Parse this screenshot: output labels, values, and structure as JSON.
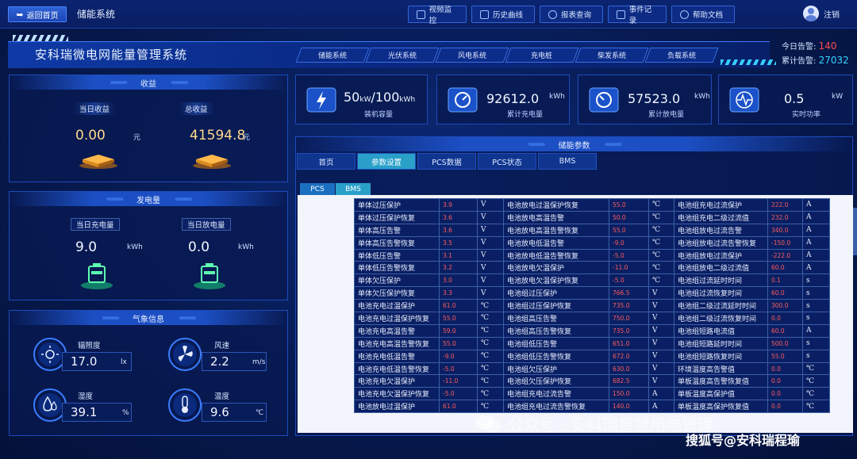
{
  "topbar": {
    "back_label": "返回首页",
    "system_name": "储能系统",
    "nav": [
      "视频监控",
      "历史曲线",
      "报表查询",
      "事件记录",
      "帮助文档"
    ],
    "user_label": "注销"
  },
  "header": {
    "title": "安科瑞微电网能量管理系统",
    "subnav": [
      "储能系统",
      "光伏系统",
      "风电系统",
      "充电桩",
      "柴发系统",
      "负载系统"
    ],
    "alarm_today_label": "今日告警:",
    "alarm_today_value": "140",
    "alarm_total_label": "累计告警:",
    "alarm_total_value": "27032"
  },
  "income": {
    "title": "收益",
    "today_label": "当日收益",
    "today_value": "0.00",
    "today_unit": "元",
    "total_label": "总收益",
    "total_value": "41594.8",
    "total_unit": "元"
  },
  "generation": {
    "title": "发电量",
    "charge_label": "当日充电量",
    "charge_value": "9.0",
    "charge_unit": "kWh",
    "discharge_label": "当日放电量",
    "discharge_value": "0.0",
    "discharge_unit": "kWh"
  },
  "weather": {
    "title": "气象信息",
    "irradiance_label": "辐照度",
    "irradiance_value": "17.0",
    "irradiance_unit": "lx",
    "wind_label": "风速",
    "wind_value": "2.2",
    "wind_unit": "m/s",
    "humidity_label": "湿度",
    "humidity_value": "39.1",
    "humidity_unit": "%",
    "temp_label": "温度",
    "temp_value": "9.6",
    "temp_unit": "℃"
  },
  "kpis": {
    "capacity_value": "50",
    "capacity_unit1": "kW",
    "capacity_sep": "/100",
    "capacity_unit2": "kWh",
    "capacity_label": "装机容量",
    "charge_value": "92612.0",
    "charge_unit": "kWh",
    "charge_label": "累计充电量",
    "discharge_value": "57523.0",
    "discharge_unit": "kWh",
    "discharge_label": "累计放电量",
    "power_value": "0.5",
    "power_unit": "kW",
    "power_label": "实时功率"
  },
  "params": {
    "title": "储能参数",
    "tabs": [
      "首页",
      "参数设置",
      "PCS数据",
      "PCS状态",
      "BMS"
    ],
    "subtabs": [
      "PCS",
      "BMS"
    ],
    "rows": [
      [
        "单体过压保护",
        "3.9",
        "V",
        "电池放电过温保护恢复",
        "55.0",
        "℃",
        "电池组充电过流保护",
        "222.0",
        "A"
      ],
      [
        "单体过压保护恢复",
        "3.6",
        "V",
        "电池放电高温告警",
        "50.0",
        "℃",
        "电池组充电二级过流值",
        "232.0",
        "A"
      ],
      [
        "单体高压告警",
        "3.6",
        "V",
        "电池放电高温告警恢复",
        "55.0",
        "℃",
        "电池组放电过流告警",
        "340.0",
        "A"
      ],
      [
        "单体高压告警恢复",
        "3.5",
        "V",
        "电池放电低温告警",
        "-9.0",
        "℃",
        "电池组放电过流告警恢复",
        "-150.0",
        "A"
      ],
      [
        "单体低压告警",
        "3.1",
        "V",
        "电池放电低温告警恢复",
        "-5.0",
        "℃",
        "电池组放电过流保护",
        "-222.0",
        "A"
      ],
      [
        "单体低压告警恢复",
        "3.2",
        "V",
        "电池放电欠温保护",
        "-11.0",
        "℃",
        "电池组放电二级过流值",
        "60.0",
        "A"
      ],
      [
        "单体欠压保护",
        "3.0",
        "V",
        "电池放电欠温保护恢复",
        "-5.0",
        "℃",
        "电池组过流延时时间",
        "0.1",
        "s"
      ],
      [
        "单体欠压保护恢复",
        "3.3",
        "V",
        "电池组过压保护",
        "766.5",
        "V",
        "电池组过流恢复时间",
        "60.0",
        "s"
      ],
      [
        "电池充电过温保护",
        "61.0",
        "℃",
        "电池组过压保护恢复",
        "735.0",
        "V",
        "电池组二级过流延时时间",
        "300.0",
        "s"
      ],
      [
        "电池充电过温保护恢复",
        "55.0",
        "℃",
        "电池组高压告警",
        "750.0",
        "V",
        "电池组二级过流恢复时间",
        "0.0",
        "s"
      ],
      [
        "电池充电高温告警",
        "59.0",
        "℃",
        "电池组高压告警恢复",
        "735.0",
        "V",
        "电池组短路电流值",
        "60.0",
        "A"
      ],
      [
        "电池充电高温告警恢复",
        "55.0",
        "℃",
        "电池组低压告警",
        "651.0",
        "V",
        "电池组短路延时时间",
        "500.0",
        "s"
      ],
      [
        "电池充电低温告警",
        "-9.0",
        "℃",
        "电池组低压告警恢复",
        "672.0",
        "V",
        "电池组短路恢复时间",
        "55.0",
        "s"
      ],
      [
        "电池充电低温告警恢复",
        "-5.0",
        "℃",
        "电池组欠压保护",
        "630.0",
        "V",
        "环境温度高告警值",
        "0.0",
        "℃"
      ],
      [
        "电池充电欠温保护",
        "-11.0",
        "℃",
        "电池组欠压保护恢复",
        "682.5",
        "V",
        "单板温度高告警恢复值",
        "0.0",
        "℃"
      ],
      [
        "电池充电欠温保护恢复",
        "-5.0",
        "℃",
        "电池组充电过流告警",
        "150.0",
        "A",
        "单板温度高保护值",
        "0.0",
        "℃"
      ],
      [
        "电池放电过温保护",
        "61.0",
        "℃",
        "电池组充电过流告警恢复",
        "140.0",
        "A",
        "单板温度高保护恢复值",
        "0.0",
        "℃"
      ]
    ]
  },
  "watermark": {
    "wechat": "公众号 · 安科瑞智慧用电管理",
    "sohu": "搜狐号@安科瑞程瑜"
  }
}
